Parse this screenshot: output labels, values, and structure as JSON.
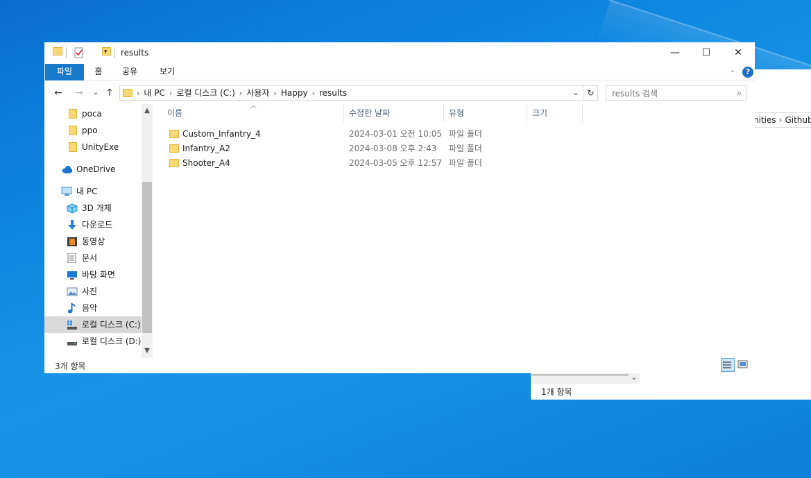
{
  "window": {
    "title": "results",
    "controls": {
      "minimize": "—",
      "maximize": "☐",
      "close": "✕"
    }
  },
  "ribbon": {
    "tabs": [
      {
        "label": "파일"
      },
      {
        "label": "홈"
      },
      {
        "label": "공유"
      },
      {
        "label": "보기"
      }
    ],
    "help": "?"
  },
  "address": {
    "breadcrumb": [
      "내 PC",
      "로컬 디스크 (C:)",
      "사용자",
      "Happy",
      "results"
    ]
  },
  "search": {
    "placeholder": "results 검색"
  },
  "nav": {
    "items": [
      {
        "label": "poca",
        "icon": "folder-icon"
      },
      {
        "label": "ppo",
        "icon": "folder-icon"
      },
      {
        "label": "UnityExe",
        "icon": "folder-icon"
      },
      {
        "label": "OneDrive",
        "icon": "cloud-icon"
      },
      {
        "label": "내 PC",
        "icon": "pc-icon"
      },
      {
        "label": "3D 개체",
        "icon": "cube-icon"
      },
      {
        "label": "다운로드",
        "icon": "download-icon"
      },
      {
        "label": "동영상",
        "icon": "video-icon"
      },
      {
        "label": "문서",
        "icon": "document-icon"
      },
      {
        "label": "바탕 화면",
        "icon": "desktop-icon"
      },
      {
        "label": "사진",
        "icon": "picture-icon"
      },
      {
        "label": "음악",
        "icon": "music-icon"
      },
      {
        "label": "로컬 디스크 (C:)",
        "icon": "drive-c-icon"
      },
      {
        "label": "로컬 디스크 (D:)",
        "icon": "drive-icon"
      }
    ]
  },
  "columns": {
    "name": "이름",
    "modified": "수정한 날짜",
    "type": "유형",
    "size": "크기"
  },
  "files": [
    {
      "name": "Custom_Infantry_4",
      "modified": "2024-03-01 오전 10:05",
      "type": "파일 폴더"
    },
    {
      "name": "Infantry_A2",
      "modified": "2024-03-08 오후 2:43",
      "type": "파일 폴더"
    },
    {
      "name": "Shooter_A4",
      "modified": "2024-03-05 오후 12:57",
      "type": "파일 폴더"
    }
  ],
  "status": {
    "count": "3개 항목"
  },
  "background_window": {
    "breadcrumb_tail": [
      "nities",
      "Github"
    ],
    "status": "1개 항목"
  },
  "colors": {
    "accent": "#1979ca",
    "folder": "#f8d775",
    "selected_nav": "#d9d9d9",
    "desktop": "#0f86e0"
  }
}
